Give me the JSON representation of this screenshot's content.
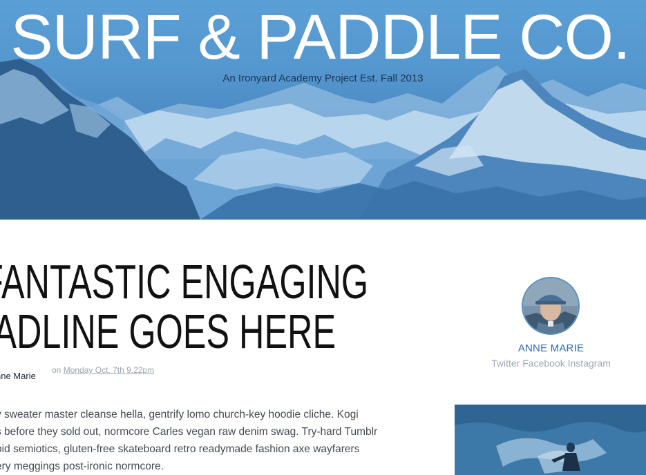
{
  "header": {
    "title": "SURF & PADDLE CO.",
    "subtitle": "An Ironyard Academy Project Est. Fall 2013"
  },
  "article": {
    "headline_line1": "FANTASTIC ENGAGING",
    "headline_line2": "EADLINE GOES HERE",
    "byline": "nne Marie",
    "date_prefix": "on",
    "date_link": "Monday Oct. 7th 9.22pm",
    "paragraph_lines": [
      "y sweater master cleanse hella, gentrify lomo church-key hoodie cliche. Kogi",
      "s before they sold out, normcore Carles vegan raw denim swag. Try-hard Tumblr",
      "pid semiotics, gluten-free skateboard retro readymade fashion axe wayfarers",
      "ery meggings post-ironic normcore."
    ]
  },
  "author": {
    "name": "ANNE MARIE",
    "socials": [
      "Twitter",
      "Facebook",
      "Instagram"
    ]
  },
  "colors": {
    "hero_blue": "#5597cf",
    "author_link": "#2b6cb3"
  }
}
